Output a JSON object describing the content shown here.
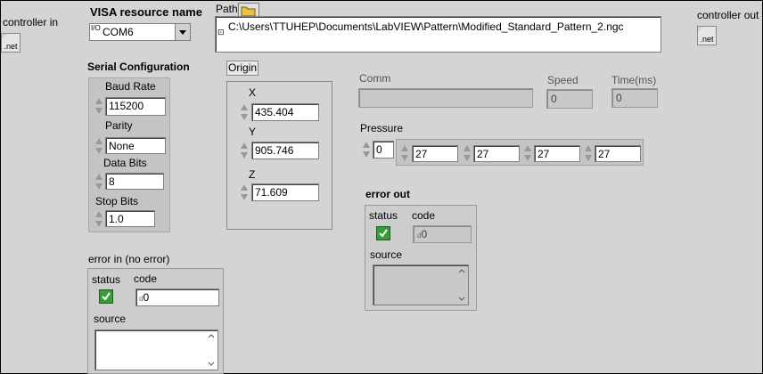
{
  "controller_in": {
    "label": "controller in",
    "icon_text": ".net"
  },
  "controller_out": {
    "label": "controller out",
    "icon_text": ".net"
  },
  "visa": {
    "label": "VISA resource name",
    "value": "COM6",
    "prefix": "I/O"
  },
  "path": {
    "label": "Path",
    "value": "C:\\Users\\TTUHEP\\Documents\\LabVIEW\\Pattern\\Modified_Standard_Pattern_2.ngc"
  },
  "serial": {
    "title": "Serial Configuration",
    "baud_label": "Baud Rate",
    "baud_value": "115200",
    "parity_label": "Parity",
    "parity_value": "None",
    "data_bits_label": "Data Bits",
    "data_bits_value": "8",
    "stop_bits_label": "Stop Bits",
    "stop_bits_value": "1.0"
  },
  "origin": {
    "title": "Origin",
    "x_label": "X",
    "x_value": "435.404",
    "y_label": "Y",
    "y_value": "905.746",
    "z_label": "Z",
    "z_value": "71.609"
  },
  "comm": {
    "label": "Comm",
    "value": ""
  },
  "speed": {
    "label": "Speed",
    "value": "0"
  },
  "time": {
    "label": "Time(ms)",
    "value": "0"
  },
  "pressure": {
    "label": "Pressure",
    "index": "0",
    "values": [
      "27",
      "27",
      "27",
      "27"
    ]
  },
  "error_in": {
    "title": "error in (no error)",
    "status_label": "status",
    "code_label": "code",
    "code_value": "0",
    "source_label": "source",
    "source_value": ""
  },
  "error_out": {
    "title": "error out",
    "status_label": "status",
    "code_label": "code",
    "code_value": "0",
    "source_label": "source",
    "source_value": ""
  },
  "colors": {
    "background": "#d4d4d4",
    "status_ok": "#3a9a3a"
  }
}
